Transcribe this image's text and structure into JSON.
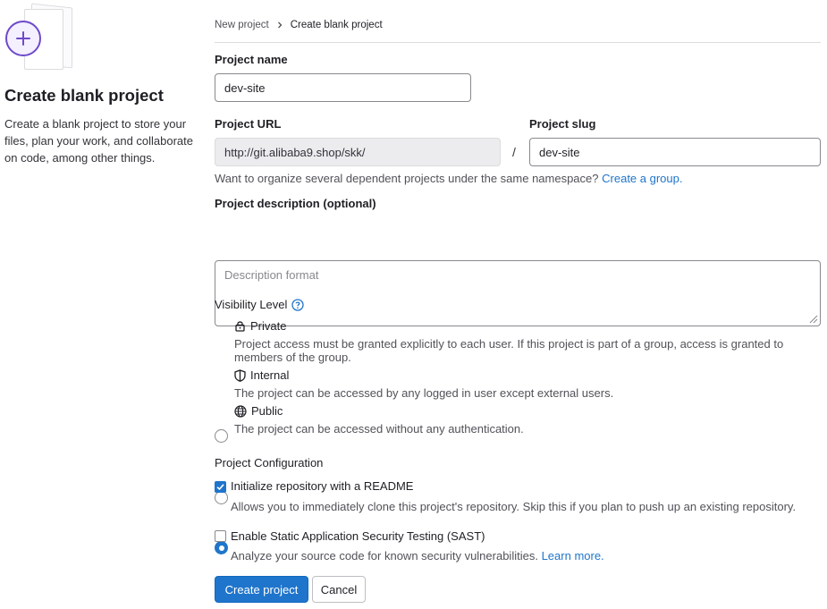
{
  "sidebar": {
    "title": "Create blank project",
    "description": "Create a blank project to store your files, plan your work, and collaborate on code, among other things.",
    "illustration_icon": "plus-circle-icon",
    "accent_color": "#6e49cb"
  },
  "breadcrumb": {
    "items": [
      "New project",
      "Create blank project"
    ]
  },
  "form": {
    "project_name_label": "Project name",
    "project_name_value": "dev-site",
    "project_url_label": "Project URL",
    "project_url_value": "http://git.alibaba9.shop/skk/",
    "slash": "/",
    "project_slug_label": "Project slug",
    "project_slug_value": "dev-site",
    "namespace_help": "Want to organize several dependent projects under the same namespace?",
    "create_group_link": "Create a group.",
    "description_label": "Project description (optional)",
    "description_placeholder": "Description format"
  },
  "visibility": {
    "label": "Visibility Level",
    "help_icon": "question-circle-icon",
    "options": [
      {
        "label": "Private",
        "icon": "lock-icon",
        "checked": false,
        "description_line1": "Project access must be granted explicitly to each user. If this project is part of a group, access is granted to",
        "description_line2": "members of the group."
      },
      {
        "label": "Internal",
        "icon": "shield-icon",
        "checked": false,
        "description_line1": "The project can be accessed by any logged in user except external users."
      },
      {
        "label": "Public",
        "icon": "globe-icon",
        "checked": true,
        "description_line1": "The project can be accessed without any authentication."
      }
    ]
  },
  "configuration": {
    "label": "Project Configuration",
    "readme": {
      "label": "Initialize repository with a README",
      "checked": true,
      "description": "Allows you to immediately clone this project's repository. Skip this if you plan to push up an existing repository."
    },
    "sast": {
      "label": "Enable Static Application Security Testing (SAST)",
      "checked": false,
      "description": "Analyze your source code for known security vulnerabilities.",
      "learn_more": "Learn more."
    }
  },
  "actions": {
    "create_label": "Create project",
    "cancel_label": "Cancel"
  },
  "colors": {
    "primary": "#1f75cb",
    "link": "#1f75cb",
    "text": "#1f1e24"
  }
}
